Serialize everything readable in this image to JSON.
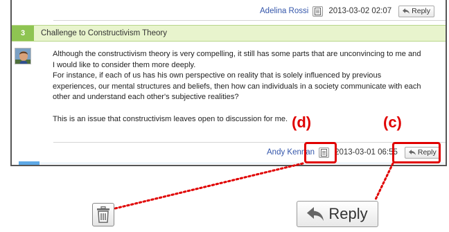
{
  "previous_post": {
    "author": "Adelina Rossi",
    "date": "2013-03-02 02:07",
    "reply_label": "Reply"
  },
  "thread": {
    "number": "3",
    "title": "Challenge to Constructivism Theory"
  },
  "post": {
    "lines": [
      "Although the constructivism theory is very compelling, it still has some parts that are unconvincing to me and",
      "I would like to consider them more deeply.",
      "For instance, if each of us has his own perspective on reality that is solely influenced by previous",
      "experiences, our mental structures and beliefs, then how can individuals in a society communicate with each",
      "other and understand each other's subjective realities?"
    ],
    "closing_line": "This is an issue that constructivism leaves open to discussion for me.",
    "author": "Andy Kennan",
    "date": "2013-03-01 06:55",
    "reply_label": "Reply"
  },
  "callouts": {
    "d": "(d)",
    "c": "(c)"
  },
  "zoom": {
    "reply_label": "Reply"
  },
  "icons": {
    "document": "document-icon",
    "reply_arrow": "reply-arrow-icon",
    "trash": "trash-icon"
  },
  "colors": {
    "accent_green": "#8ec452",
    "header_green": "#e8f4cd",
    "highlight_red": "#e00000",
    "author_blue": "#3355aa"
  }
}
